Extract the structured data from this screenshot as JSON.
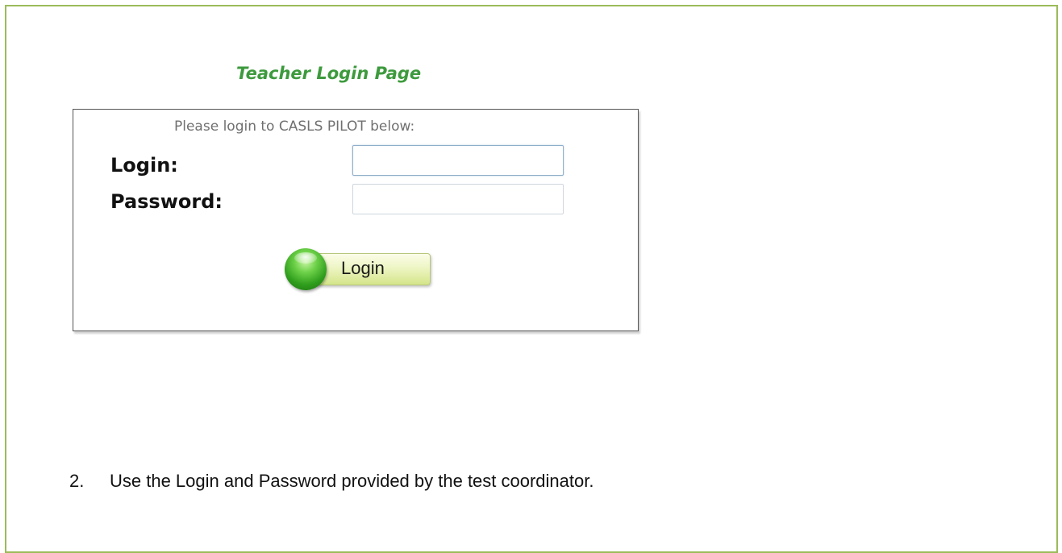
{
  "page": {
    "title": "Teacher Login Page",
    "accent_color": "#9bbb59",
    "title_color": "#3d9a3d"
  },
  "login_box": {
    "prompt": "Please login to CASLS PILOT below:",
    "login_label": "Login:",
    "login_value": "",
    "password_label": "Password:",
    "password_value": "",
    "button_label": "Login",
    "button_icon": "green-orb-icon"
  },
  "instruction": {
    "number": "2.",
    "text": "Use the Login and Password provided by the test coordinator."
  }
}
